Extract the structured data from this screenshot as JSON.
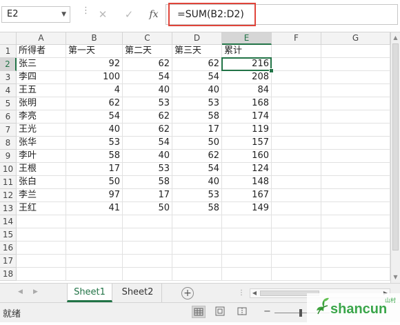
{
  "formula_bar": {
    "name_box": "E2",
    "cancel_icon": "✕",
    "enter_icon": "✓",
    "fx_icon": "fx",
    "formula": "=SUM(B2:D2)",
    "highlight_color": "#e0443a"
  },
  "sheet": {
    "columns": [
      "A",
      "B",
      "C",
      "D",
      "E",
      "F",
      "G"
    ],
    "rows": [
      "1",
      "2",
      "3",
      "4",
      "5",
      "6",
      "7",
      "8",
      "9",
      "10",
      "11",
      "12",
      "13",
      "14",
      "15",
      "16",
      "17",
      "18"
    ],
    "selected_column": "E",
    "selected_row": "2",
    "active_cell": "E2",
    "headers": [
      "所得者",
      "第一天",
      "第二天",
      "第三天",
      "累计"
    ],
    "data": [
      [
        "张三",
        "92",
        "62",
        "62",
        "216"
      ],
      [
        "李四",
        "100",
        "54",
        "54",
        "208"
      ],
      [
        "王五",
        "4",
        "40",
        "40",
        "84"
      ],
      [
        "张明",
        "62",
        "53",
        "53",
        "168"
      ],
      [
        "李亮",
        "54",
        "62",
        "58",
        "174"
      ],
      [
        "王光",
        "40",
        "62",
        "17",
        "119"
      ],
      [
        "张华",
        "53",
        "54",
        "50",
        "157"
      ],
      [
        "李叶",
        "58",
        "40",
        "62",
        "160"
      ],
      [
        "王根",
        "17",
        "53",
        "54",
        "124"
      ],
      [
        "张白",
        "50",
        "58",
        "40",
        "148"
      ],
      [
        "李兰",
        "97",
        "17",
        "53",
        "167"
      ],
      [
        "王红",
        "41",
        "50",
        "58",
        "149"
      ]
    ],
    "accent_color": "#217346"
  },
  "tabs": {
    "items": [
      "Sheet1",
      "Sheet2"
    ],
    "active": "Sheet1",
    "add_icon": "+"
  },
  "status": {
    "text": "就绪"
  },
  "watermark": {
    "text": "shancun",
    "sub": "山村"
  }
}
